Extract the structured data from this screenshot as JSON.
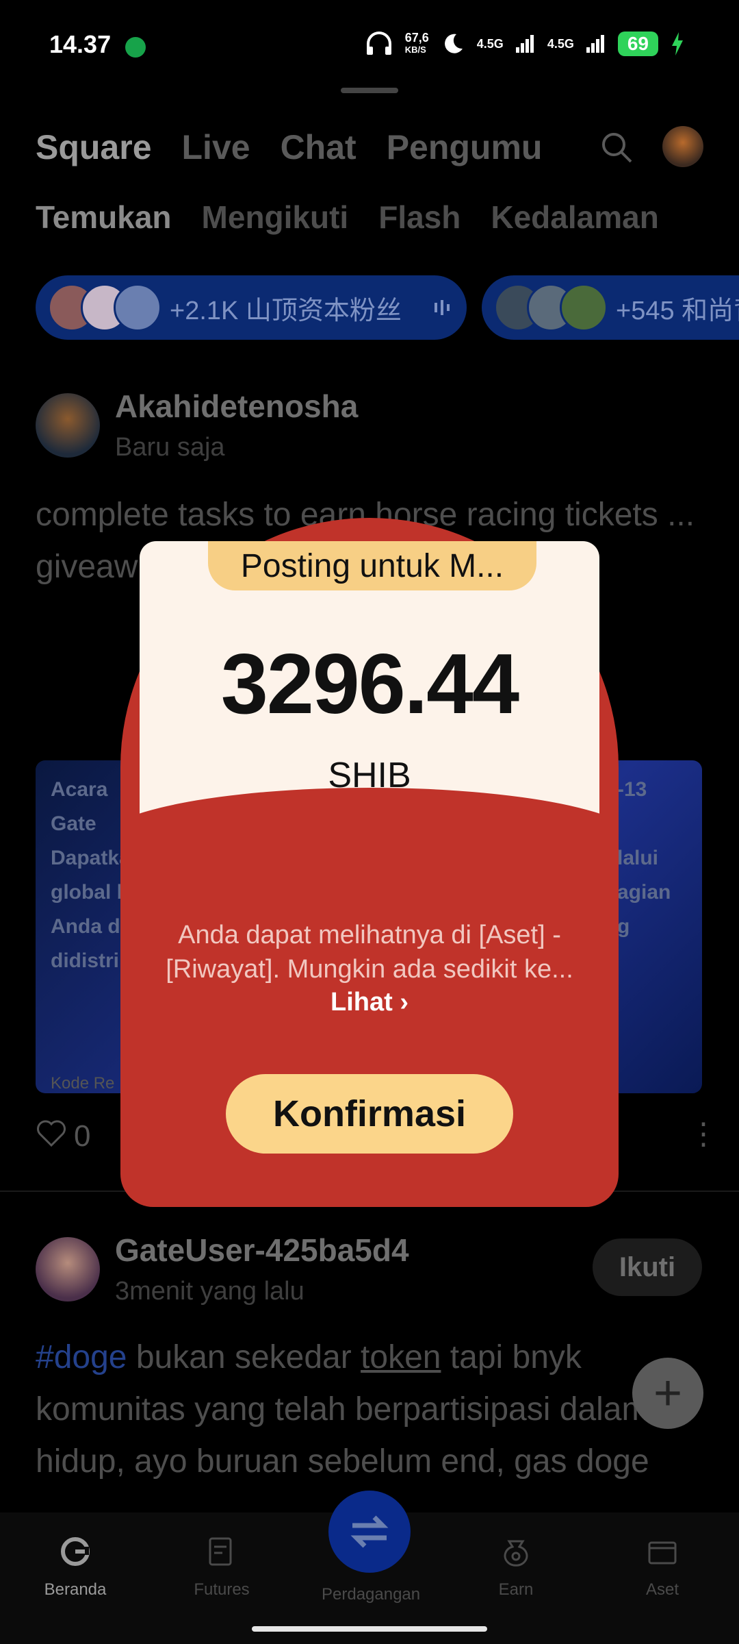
{
  "status_bar": {
    "time": "14.37",
    "net_speed_value": "67,6",
    "net_speed_unit": "KB/S",
    "signal1": "4.5G",
    "signal2": "4.5G",
    "battery": "69"
  },
  "top_tabs": [
    "Square",
    "Live",
    "Chat",
    "Pengumu"
  ],
  "sub_tabs": [
    "Temukan",
    "Mengikuti",
    "Flash",
    "Kedalaman"
  ],
  "chips": [
    {
      "label": "+2.1K 山顶资本粉丝"
    },
    {
      "label": "+545 和尚背"
    }
  ],
  "post1": {
    "author": "Akahidetenosha",
    "time": "Baru saja",
    "text": "complete tasks to earn horse racing tickets ... giveaw ... OT prize p ... ng Festiv",
    "banner_left": "Acara\nGate\nDapatka\nglobal b\nAnda da\ndidistrib",
    "banner_right": "-13\n\nlalui\nagian\ng",
    "banner_bottom": "Kode Re",
    "likes": "0"
  },
  "post2": {
    "author": "GateUser-425ba5d4",
    "time": "3menit yang lalu",
    "follow_label": "Ikuti",
    "hashtag": "#doge",
    "text_a": " bukan sekedar ",
    "text_ul": "token",
    "text_b": " tapi bnyk komunitas yang telah berpartisipasi dalam hidup, ayo buruan sebelum end, gas doge"
  },
  "modal": {
    "banner": "Posting untuk M...",
    "amount": "3296.44",
    "unit": "SHIB",
    "message": "Anda dapat melihatnya di [Aset] - [Riwayat]. Mungkin ada sedikit ke...",
    "link": "Lihat ›",
    "confirm_label": "Konfirmasi"
  },
  "bottom_nav": [
    {
      "label": "Beranda",
      "icon": "home-icon"
    },
    {
      "label": "Futures",
      "icon": "futures-icon"
    },
    {
      "label": "Perdagangan",
      "icon": "trade-icon"
    },
    {
      "label": "Earn",
      "icon": "earn-icon"
    },
    {
      "label": "Aset",
      "icon": "wallet-icon"
    }
  ],
  "colors": {
    "modal_red": "#c0332a",
    "card_cream": "#fdf3ea",
    "button_gold": "#fbd58a",
    "chip_blue": "#0b2a72"
  }
}
